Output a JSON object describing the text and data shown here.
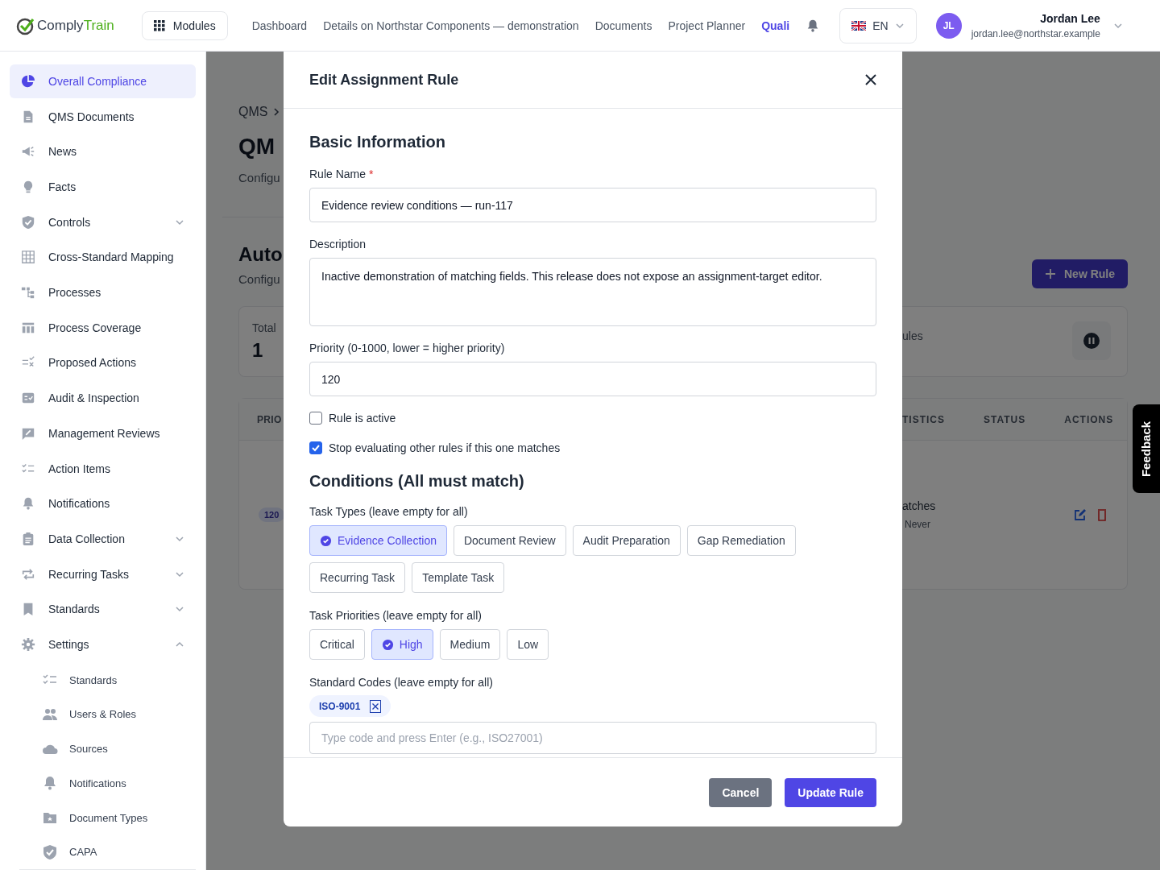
{
  "header": {
    "logo": {
      "part_1": "Comply",
      "part_2": "Train"
    },
    "modules_button": "Modules",
    "nav": [
      {
        "label": "Dashboard",
        "selected": false
      },
      {
        "label": "Details on Northstar Components — demonstration",
        "selected": false
      },
      {
        "label": "Documents",
        "selected": false
      },
      {
        "label": "Project Planner",
        "selected": false
      },
      {
        "label": "Quali",
        "selected": true
      }
    ],
    "language": "EN",
    "user": {
      "initials": "JL",
      "name": "Jordan Lee",
      "email": "jordan.lee@northstar.example"
    }
  },
  "sidebar": {
    "items": [
      {
        "label": "Overall Compliance",
        "selected": true
      },
      {
        "label": "QMS Documents",
        "selected": false
      },
      {
        "label": "News",
        "selected": false
      },
      {
        "label": "Facts",
        "selected": false
      },
      {
        "label": "Controls",
        "selected": false,
        "expanded": false
      },
      {
        "label": "Cross-Standard Mapping",
        "selected": false
      },
      {
        "label": "Processes",
        "selected": false
      },
      {
        "label": "Process Coverage",
        "selected": false
      },
      {
        "label": "Proposed Actions",
        "selected": false
      },
      {
        "label": "Audit & Inspection",
        "selected": false
      },
      {
        "label": "Management Reviews",
        "selected": false
      },
      {
        "label": "Action Items",
        "selected": false
      },
      {
        "label": "Notifications",
        "selected": false
      },
      {
        "label": "Data Collection",
        "selected": false,
        "expanded": false
      },
      {
        "label": "Recurring Tasks",
        "selected": false,
        "expanded": false
      },
      {
        "label": "Standards",
        "selected": false,
        "expanded": false
      },
      {
        "label": "Settings",
        "selected": false,
        "expanded": true,
        "children": [
          {
            "label": "Standards",
            "selected": false
          },
          {
            "label": "Users & Roles",
            "selected": false
          },
          {
            "label": "Sources",
            "selected": false
          },
          {
            "label": "Notifications",
            "selected": false
          },
          {
            "label": "Document Types",
            "selected": false
          },
          {
            "label": "CAPA",
            "selected": false
          }
        ]
      }
    ]
  },
  "background_page": {
    "breadcrumb": "QMS",
    "title": "QM",
    "subtitle": "Configu",
    "section_title": "Auto",
    "section_subtitle": "Configu",
    "new_rule_button": "New Rule",
    "stats_card": {
      "label_left": "Total",
      "value": "1",
      "label_right": "ules"
    },
    "table": {
      "columns_left": [
        "PRIO"
      ],
      "columns_right": [
        "TISTICS",
        "STATUS",
        "ACTIONS"
      ],
      "rows": [
        {
          "priority": "120",
          "statistics": "atches",
          "last_match": "Never"
        }
      ]
    }
  },
  "modal": {
    "title": "Edit Assignment Rule",
    "section_1": "Basic Information",
    "rule_name": {
      "label": "Rule Name",
      "required_mark": "*",
      "value": "Evidence review conditions — run-117"
    },
    "description": {
      "label": "Description",
      "value": "Inactive demonstration of matching fields. This release does not expose an assignment-target editor."
    },
    "priority": {
      "label": "Priority (0-1000, lower = higher priority)",
      "value": "120"
    },
    "checkboxes": [
      {
        "label": "Rule is active",
        "checked": false
      },
      {
        "label": "Stop evaluating other rules if this one matches",
        "checked": true
      }
    ],
    "section_2": "Conditions (All must match)",
    "task_types": {
      "label": "Task Types (leave empty for all)",
      "options": [
        {
          "label": "Evidence Collection",
          "selected": true
        },
        {
          "label": "Document Review",
          "selected": false
        },
        {
          "label": "Audit Preparation",
          "selected": false
        },
        {
          "label": "Gap Remediation",
          "selected": false
        },
        {
          "label": "Recurring Task",
          "selected": false
        },
        {
          "label": "Template Task",
          "selected": false
        }
      ]
    },
    "task_priorities": {
      "label": "Task Priorities (leave empty for all)",
      "options": [
        {
          "label": "Critical",
          "selected": false
        },
        {
          "label": "High",
          "selected": true
        },
        {
          "label": "Medium",
          "selected": false
        },
        {
          "label": "Low",
          "selected": false
        }
      ]
    },
    "standard_codes": {
      "label": "Standard Codes (leave empty for all)",
      "tags": [
        "ISO-9001"
      ],
      "placeholder": "Type code and press Enter (e.g., ISO27001)"
    },
    "buttons": {
      "cancel": "Cancel",
      "submit": "Update Rule"
    }
  },
  "feedback_tab": "Feedback"
}
